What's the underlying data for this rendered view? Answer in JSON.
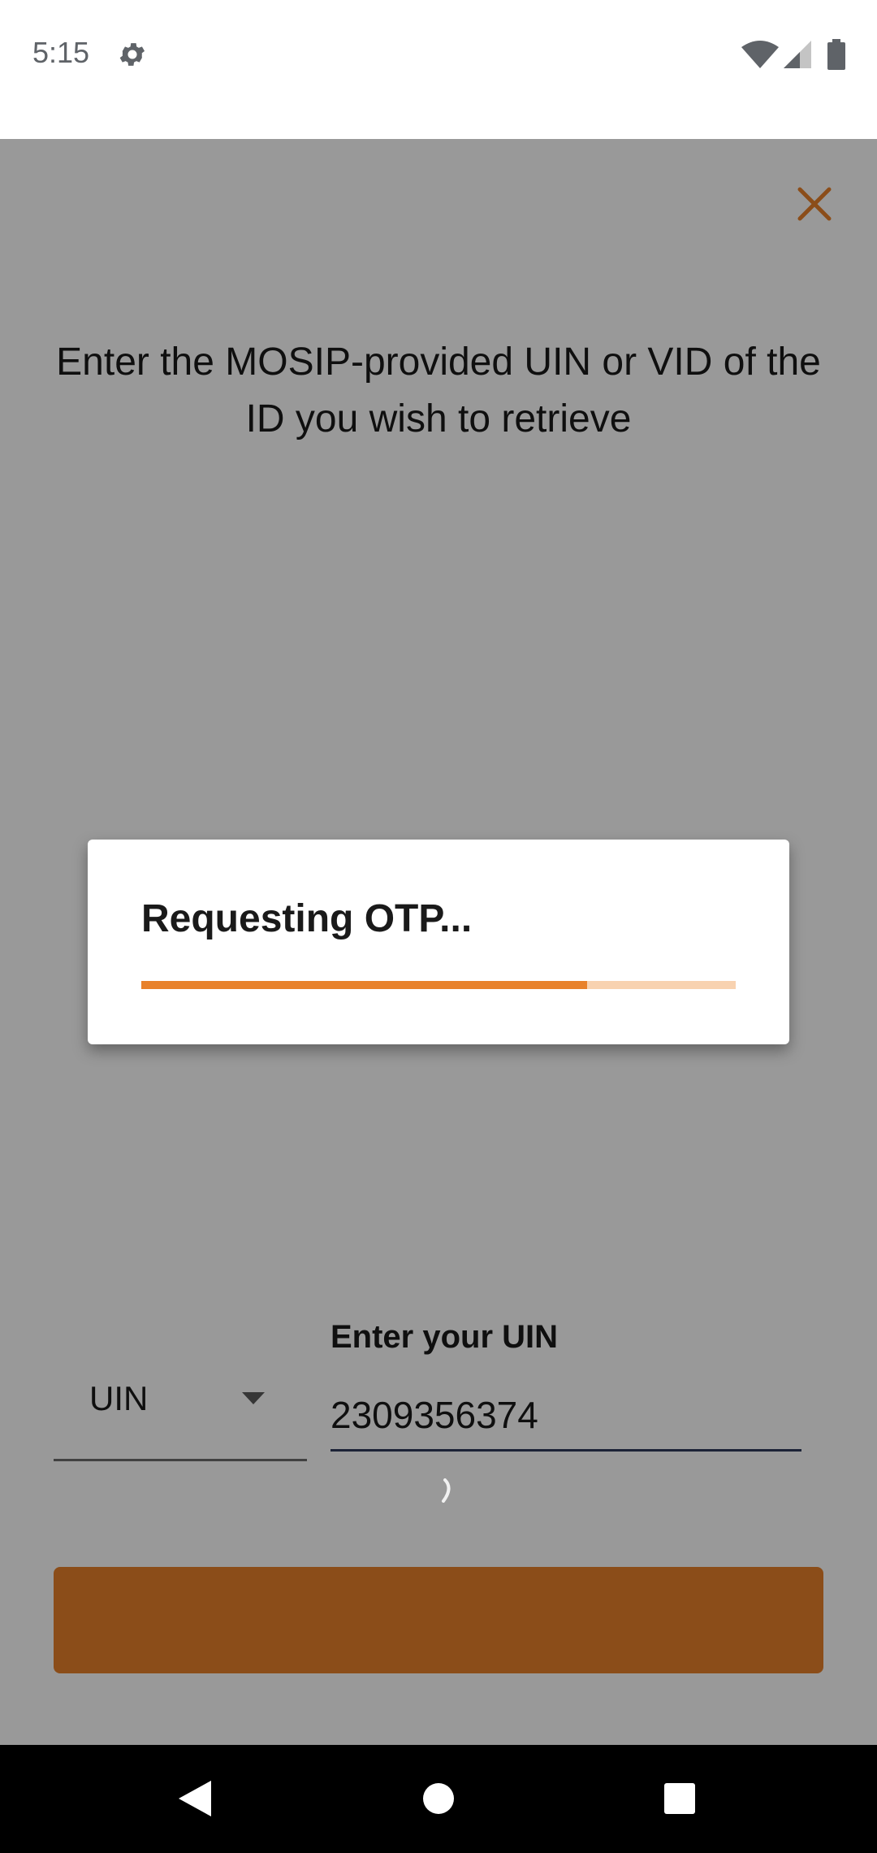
{
  "status_bar": {
    "time": "5:15",
    "icons": [
      "gear-icon",
      "wifi-icon",
      "signal-icon",
      "battery-icon"
    ]
  },
  "screen": {
    "close_icon": "close-icon",
    "instructions": "Enter the MOSIP-provided UIN or VID of the ID you wish to retrieve",
    "id_type": {
      "selected": "UIN",
      "icon": "chevron-down-icon"
    },
    "uin_field": {
      "label": "Enter your UIN",
      "value": "2309356374"
    },
    "submit_button": {
      "state": "loading",
      "icon": "spinner-icon"
    }
  },
  "dialog": {
    "title": "Requesting OTP...",
    "progress": 0.75
  },
  "colors": {
    "accent": "#e8812a",
    "accent_light": "#f8d2b0",
    "scrim": "#000000",
    "input_underline": "#2f3b5c"
  },
  "nav_bar": {
    "icons": [
      "back-icon",
      "home-icon",
      "recents-icon"
    ]
  }
}
